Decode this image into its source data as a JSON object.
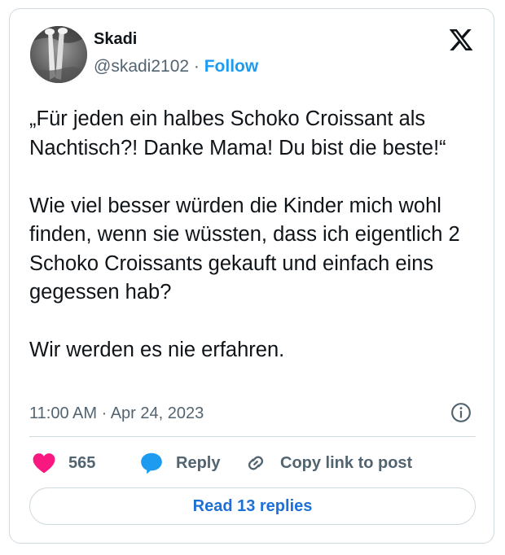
{
  "author": {
    "name": "Skadi",
    "handle": "@skadi2102",
    "separator": " · ",
    "follow_label": "Follow"
  },
  "icons": {
    "brand": "x-logo-icon",
    "info": "info-icon",
    "like": "heart-icon",
    "reply": "reply-bubble-icon",
    "copy": "link-icon"
  },
  "tweet": {
    "text": "„Für jeden ein halbes Schoko Croissant als Nachtisch?! Danke Mama! Du bist die beste!“\n\nWie viel besser würden die Kinder mich wohl finden, wenn sie wüssten, dass ich eigentlich 2 Schoko Croissants gekauft und einfach eins gegessen hab?\n\nWir werden es nie erfahren.",
    "timestamp": "11:00 AM · Apr 24, 2023"
  },
  "actions": {
    "like_count": "565",
    "reply_label": "Reply",
    "copy_label": "Copy link to post"
  },
  "read_replies_label": "Read 13 replies",
  "colors": {
    "like": "#f91880",
    "reply": "#1d9bf0",
    "link_blue": "#1d70d6",
    "muted": "#536471"
  }
}
